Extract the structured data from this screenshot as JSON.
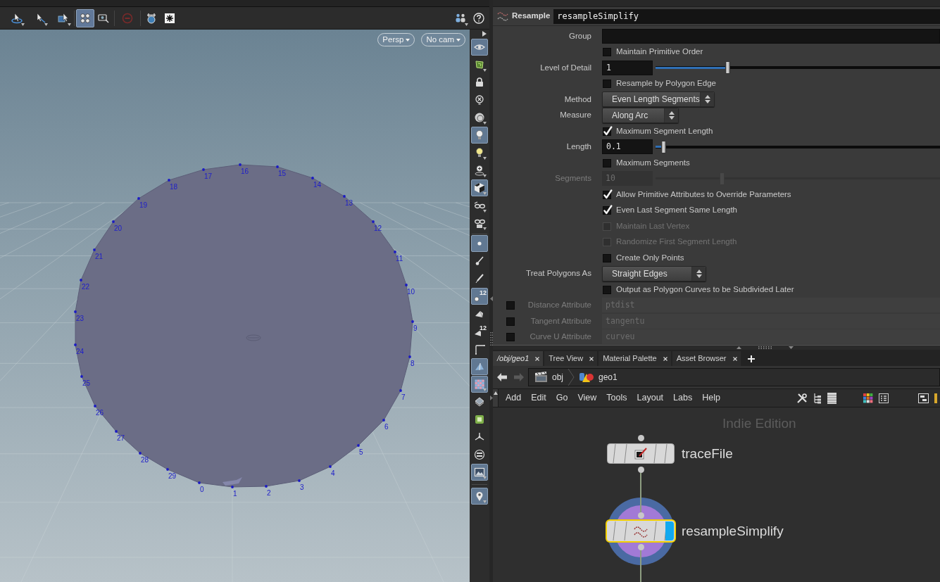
{
  "viewport_toolbar": [
    {
      "selected": false,
      "menu": true
    },
    {
      "selected": false,
      "menu": true
    },
    {
      "selected": false,
      "menu": true
    },
    {
      "selected": true,
      "menu": false
    },
    {
      "selected": false,
      "menu": false
    },
    {
      "selected": false,
      "menu": false
    },
    {
      "selected": false,
      "menu": false
    },
    {
      "selected": false,
      "menu": false
    },
    {
      "selected": false,
      "menu": true
    },
    {
      "selected": false,
      "menu": false
    }
  ],
  "viewport": {
    "view_menu": "Persp",
    "camera_menu": "No cam",
    "points": [
      "17",
      "16",
      "15",
      "18",
      "14",
      "19",
      "13",
      "20",
      "12",
      "21",
      "11",
      "22",
      "10",
      "23",
      "9",
      "24",
      "8",
      "25",
      "7",
      "26",
      "6",
      "27",
      "5",
      "28",
      "29",
      "4",
      "0",
      "1",
      "2",
      "3"
    ]
  },
  "side_toolbar": [
    {
      "selected": true,
      "menu": false
    },
    {
      "selected": false,
      "menu": true
    },
    {
      "selected": false,
      "menu": false
    },
    {
      "selected": false,
      "menu": false
    },
    {
      "selected": false,
      "menu": true
    },
    {
      "selected": true,
      "menu": false
    },
    {
      "selected": false,
      "menu": true
    },
    {
      "selected": false,
      "menu": true
    },
    {
      "selected": true,
      "menu": true
    },
    {
      "selected": false,
      "menu": true
    },
    {
      "selected": false,
      "menu": true
    },
    {
      "selected": true,
      "menu": false
    },
    {
      "selected": false,
      "menu": false
    },
    {
      "selected": false,
      "menu": false
    },
    {
      "selected": true,
      "menu": false,
      "label": "12"
    },
    {
      "selected": false,
      "menu": false
    },
    {
      "selected": false,
      "menu": false,
      "label": "12"
    },
    {
      "selected": false,
      "menu": false
    },
    {
      "selected": true,
      "menu": false
    },
    {
      "selected": true,
      "menu": true
    },
    {
      "selected": false,
      "menu": false
    },
    {
      "selected": false,
      "menu": false
    },
    {
      "selected": false,
      "menu": false
    },
    {
      "selected": false,
      "menu": false
    },
    {
      "selected": true,
      "menu": true
    },
    {
      "selected": true,
      "menu": true
    }
  ],
  "parameters": {
    "node_type": "Resample",
    "node_name": "resampleSimplify",
    "rows": [
      {
        "kind": "text",
        "label": "Group"
      },
      {
        "kind": "checkbox",
        "label": "Maintain Primitive Order",
        "checked": false,
        "disabled": false
      },
      {
        "kind": "number",
        "label": "Level of Detail",
        "value": "1",
        "level": 0.25,
        "disabled": false
      },
      {
        "kind": "checkbox",
        "label": "Resample by Polygon Edge",
        "checked": false,
        "disabled": false
      },
      {
        "kind": "menu",
        "label": "Method",
        "value": "Even Length Segments"
      },
      {
        "kind": "menu",
        "label": "Measure",
        "value": "Along Arc"
      },
      {
        "kind": "checkbox",
        "label": "Maximum Segment Length",
        "checked": true,
        "disabled": false
      },
      {
        "kind": "number",
        "label": "Length",
        "value": "0.1",
        "level": 0.02,
        "disabled": false
      },
      {
        "kind": "checkbox",
        "label": "Maximum Segments",
        "checked": false,
        "disabled": false
      },
      {
        "kind": "number",
        "label": "Segments",
        "value": "10",
        "level": 0.23,
        "disabled": true
      },
      {
        "kind": "checkbox",
        "label": "Allow Primitive Attributes to Override Parameters",
        "checked": true,
        "disabled": false
      },
      {
        "kind": "checkbox",
        "label": "Even Last Segment Same Length",
        "checked": true,
        "disabled": false
      },
      {
        "kind": "checkbox",
        "label": "Maintain Last Vertex",
        "checked": false,
        "disabled": true
      },
      {
        "kind": "checkbox",
        "label": "Randomize First Segment Length",
        "checked": false,
        "disabled": true
      },
      {
        "kind": "checkbox",
        "label": "Create Only Points",
        "checked": false,
        "disabled": false
      },
      {
        "kind": "menu",
        "label": "Treat Polygons As",
        "value": "Straight Edges"
      },
      {
        "kind": "checkbox",
        "label": "Output as Polygon Curves to be Subdivided Later",
        "checked": false,
        "disabled": false
      },
      {
        "kind": "attribute",
        "label": "Distance Attribute",
        "value": "ptdist",
        "checked": false
      },
      {
        "kind": "attribute",
        "label": "Tangent Attribute",
        "value": "tangentu",
        "checked": false
      },
      {
        "kind": "attribute",
        "label": "Curve U Attribute",
        "value": "curveu",
        "checked": false
      }
    ]
  },
  "network": {
    "tabs": [
      {
        "label": "/obj/geo1",
        "selected": true
      },
      {
        "label": "Tree View",
        "selected": false
      },
      {
        "label": "Material Palette",
        "selected": false
      },
      {
        "label": "Asset Browser",
        "selected": false
      }
    ],
    "path": [
      "obj",
      "geo1"
    ],
    "menu": [
      "Add",
      "Edit",
      "Go",
      "View",
      "Tools",
      "Layout",
      "Labs",
      "Help"
    ],
    "edition": "Indie Edition",
    "nodes": [
      {
        "name": "traceFile",
        "selected": false,
        "display": false
      },
      {
        "name": "resampleSimplify",
        "selected": true,
        "display": true
      }
    ]
  }
}
